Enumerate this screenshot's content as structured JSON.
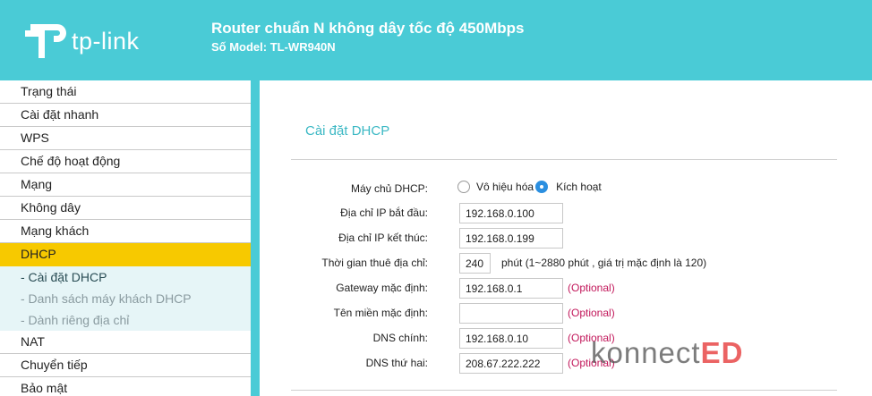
{
  "header": {
    "brand": "tp-link",
    "title": "Router chuẩn N không dây tốc độ 450Mbps",
    "model": "Số Model: TL-WR940N"
  },
  "sidebar": {
    "items_top": [
      "Trạng thái",
      "Cài đặt nhanh",
      "WPS",
      "Chế độ hoạt động",
      "Mạng",
      "Không dây",
      "Mạng khách"
    ],
    "active": "DHCP",
    "sub_items": [
      "- Cài đặt DHCP",
      "- Danh sách máy khách DHCP",
      "- Dành riêng địa chỉ"
    ],
    "items_bottom": [
      "NAT",
      "Chuyển tiếp",
      "Bảo mật"
    ]
  },
  "page": {
    "title": "Cài đặt DHCP"
  },
  "form": {
    "dhcp_server_label": "Máy chủ DHCP:",
    "disable_label": "Vô hiệu hóa",
    "enable_label": "Kích hoạt",
    "start_ip_label": "Địa chỉ IP bắt đầu:",
    "start_ip": "192.168.0.100",
    "end_ip_label": "Địa chỉ IP kết thúc:",
    "end_ip": "192.168.0.199",
    "lease_label": "Thời gian thuê địa chỉ:",
    "lease": "240",
    "lease_hint": "phút (1~2880 phút , giá trị mặc định là 120)",
    "gateway_label": "Gateway mặc định:",
    "gateway": "192.168.0.1",
    "domain_label": "Tên miền mặc định:",
    "domain": "",
    "dns1_label": "DNS chính:",
    "dns1": "192.168.0.10",
    "dns2_label": "DNS thứ hai:",
    "dns2": "208.67.222.222",
    "optional": "(Optional)"
  },
  "watermark": {
    "prefix": "konnect",
    "suffix": "ED"
  },
  "colors": {
    "accent": "#4acbd6",
    "active_menu": "#f7c900",
    "optional": "#c2185b",
    "radio_checked": "#2b8fe0"
  }
}
